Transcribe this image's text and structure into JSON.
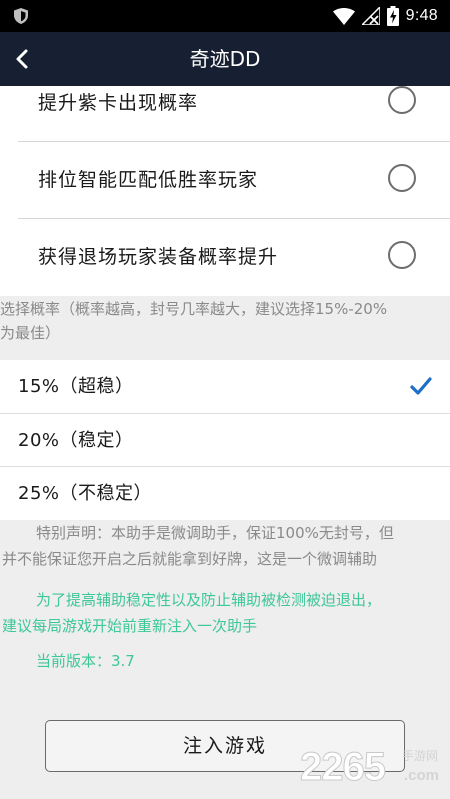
{
  "status_bar": {
    "time": "9:48",
    "icons": [
      "shield-icon",
      "wifi-icon",
      "no-signal-icon",
      "battery-charging-icon"
    ]
  },
  "app_bar": {
    "title": "奇迹DD",
    "back_icon": "back-arrow-icon"
  },
  "options": [
    {
      "label": "提升紫卡出现概率",
      "checked": false
    },
    {
      "label": "排位智能匹配低胜率玩家",
      "checked": false
    },
    {
      "label": "获得退场玩家装备概率提升",
      "checked": false
    }
  ],
  "rate_hint": {
    "line1": "选择概率（概率越高，封号几率越大，建议选择15%-20%",
    "line2": "为最佳）"
  },
  "rates": [
    {
      "label": "15%（超稳）",
      "selected": true
    },
    {
      "label": "20%（稳定）",
      "selected": false
    },
    {
      "label": "25%（不稳定）",
      "selected": false
    }
  ],
  "disclaimer": {
    "line1": "特别声明：本助手是微调助手，保证100%无封号，但",
    "line2": "并不能保证您开启之后就能拿到好牌，这是一个微调辅助"
  },
  "stability_note": {
    "line1": "为了提高辅助稳定性以及防止辅助被检测被迫退出，",
    "line2": "建议每局游戏开始前重新注入一次助手"
  },
  "version": "当前版本：3.7",
  "inject_button": "注入游戏",
  "watermark": {
    "number": "2265",
    "suffix": ".com",
    "tag": "手游网"
  },
  "colors": {
    "status_bar": "#000000",
    "app_bar": "#172033",
    "check": "#1e6fc7",
    "green_text": "#3ec797",
    "background": "#eeeeee"
  }
}
